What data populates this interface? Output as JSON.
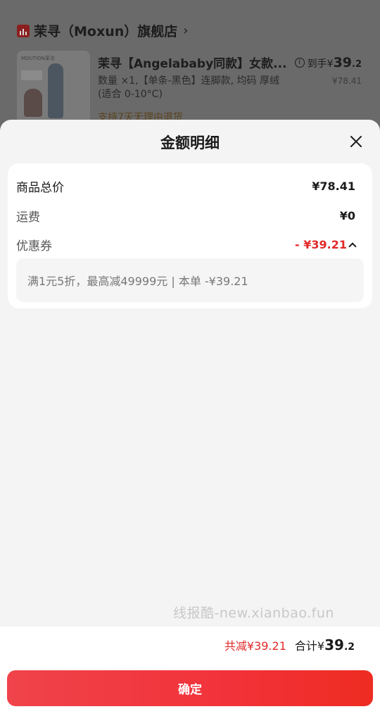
{
  "background": {
    "store_name": "茉寻（Moxun）旗舰店",
    "product": {
      "title": "茉寻【Angelababy同款】女款...",
      "spec": "数量 ×1,【单条-黑色】连脚款, 均码 厚绒 (适合 0-10°C)",
      "return_policy": "支持7天无理由退货",
      "final_price_label": "到手¥",
      "final_price_int": "39",
      "final_price_dec": ".2",
      "original_price": "¥78.41",
      "thumb_brand": "MOUTION茉寻"
    }
  },
  "sheet": {
    "title": "金额明细",
    "rows": [
      {
        "label": "商品总价",
        "value": "¥78.41"
      },
      {
        "label": "运费",
        "value": "¥0"
      },
      {
        "label": "优惠券",
        "value": "- ¥39.21"
      }
    ],
    "coupon_detail": "满1元5折，最高减49999元 | 本单 -¥39.21"
  },
  "watermark": "线报酷-new.xianbao.fun",
  "footer": {
    "saved": "共减¥39.21",
    "total_label": "合计",
    "total_currency": "¥",
    "total_int": "39",
    "total_dec": ".2",
    "confirm_label": "确定"
  },
  "colors": {
    "accent_red": "#e22a2a",
    "button_gradient_start": "#f0434a",
    "button_gradient_end": "#ee2c22"
  }
}
